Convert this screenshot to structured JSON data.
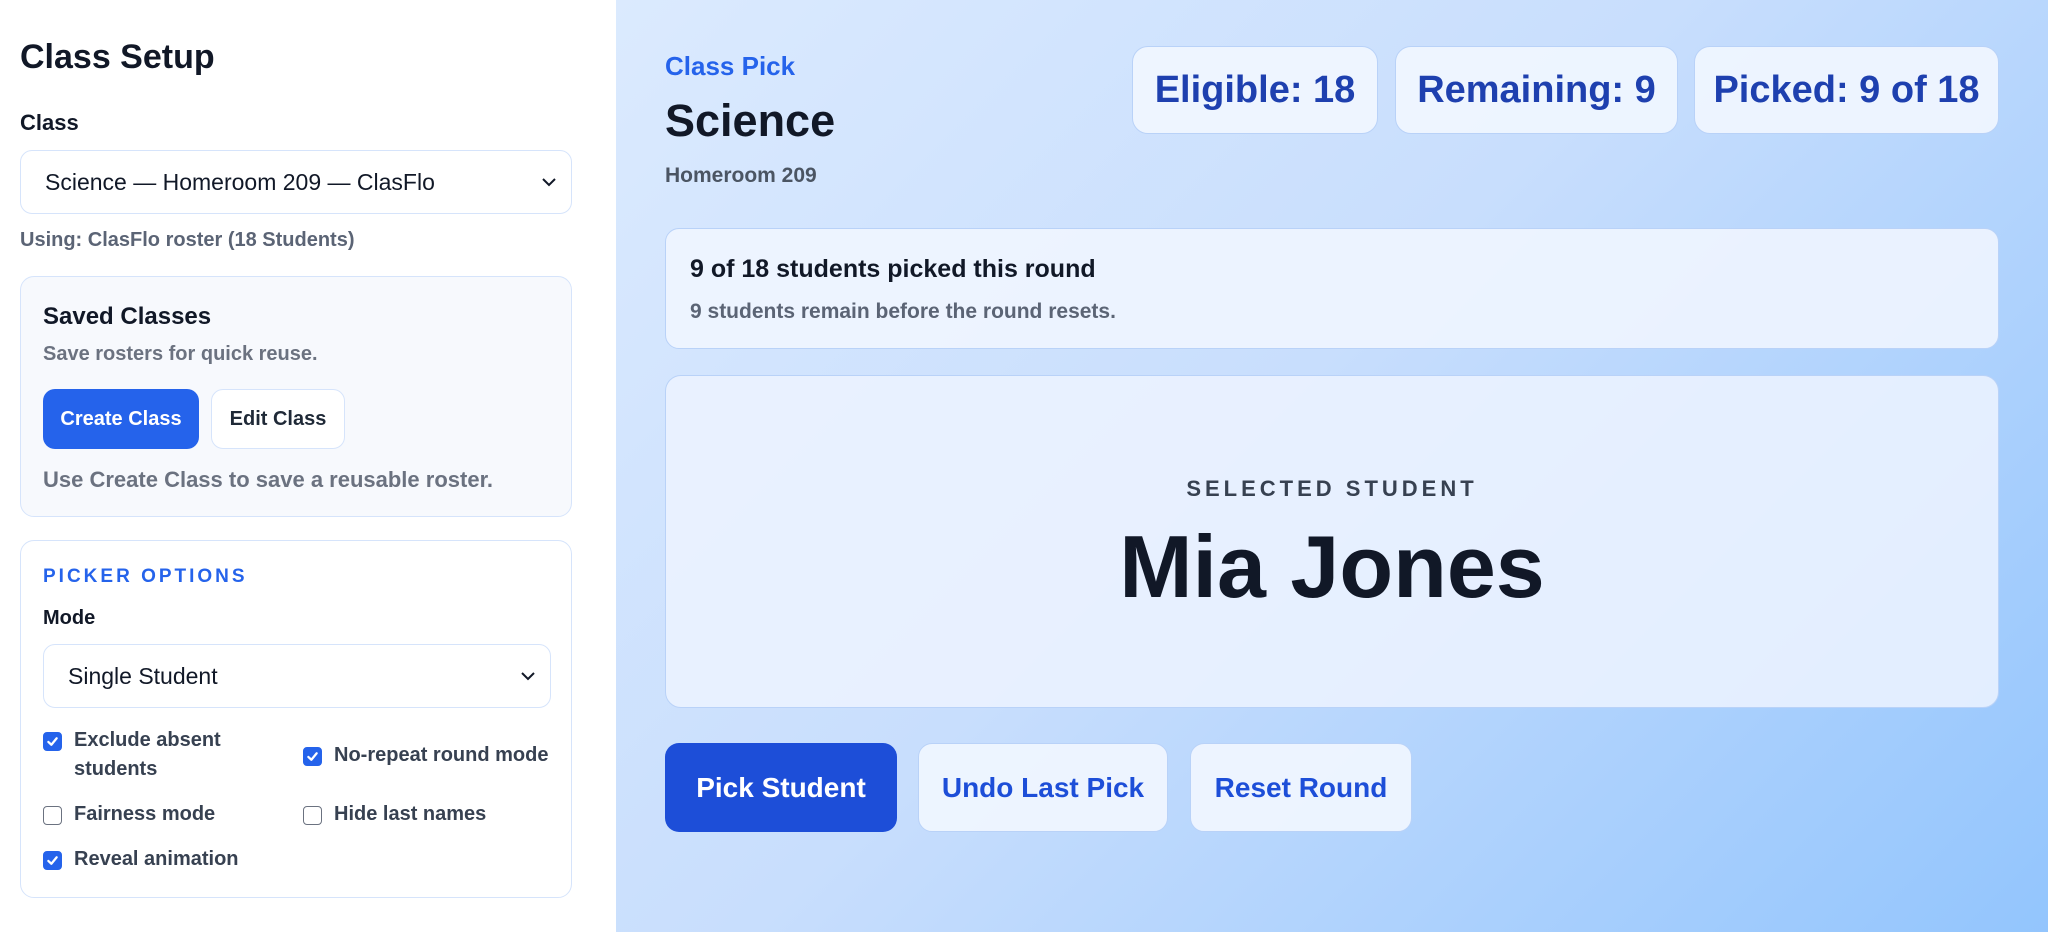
{
  "sidebar": {
    "title": "Class Setup",
    "class_label": "Class",
    "class_select_value": "Science — Homeroom 209 — ClasFlo",
    "using_note": "Using: ClasFlo roster (18 Students)",
    "saved": {
      "title": "Saved Classes",
      "subtitle": "Save rosters for quick reuse.",
      "create_label": "Create Class",
      "edit_label": "Edit Class",
      "hint": "Use Create Class to save a reusable roster."
    },
    "options": {
      "heading": "PICKER OPTIONS",
      "mode_label": "Mode",
      "mode_value": "Single Student",
      "checkboxes": [
        {
          "label": "Exclude absent students",
          "checked": true
        },
        {
          "label": "No-repeat round mode",
          "checked": true
        },
        {
          "label": "Fairness mode",
          "checked": false
        },
        {
          "label": "Hide last names",
          "checked": false
        },
        {
          "label": "Reveal animation",
          "checked": true
        }
      ]
    }
  },
  "main": {
    "eyebrow": "Class Pick",
    "title": "Science",
    "subtitle": "Homeroom 209",
    "stats": {
      "eligible": "Eligible: 18",
      "remaining": "Remaining: 9",
      "picked": "Picked: 9 of 18"
    },
    "progress": {
      "main": "9 of 18 students picked this round",
      "sub": "9 students remain before the round resets."
    },
    "selected": {
      "label": "SELECTED STUDENT",
      "name": "Mia Jones"
    },
    "actions": {
      "pick": "Pick Student",
      "undo": "Undo Last Pick",
      "reset": "Reset Round"
    }
  },
  "colors": {
    "accent": "#2563eb",
    "accent_dark": "#1d4ed8",
    "stat_text": "#1e40af",
    "main_bg_start": "#dbeafe",
    "main_bg_end": "#93c5fd"
  },
  "icons": {
    "select_arrow": "chevron-down-icon",
    "checkbox_check": "check-icon"
  }
}
